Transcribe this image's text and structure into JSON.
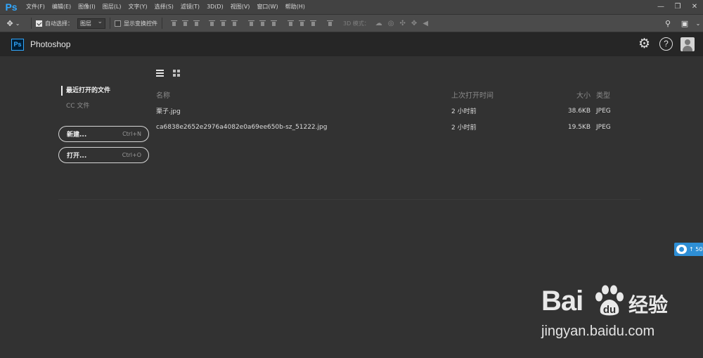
{
  "menubar": {
    "logo": "Ps",
    "items": [
      "文件(F)",
      "编辑(E)",
      "图像(I)",
      "图层(L)",
      "文字(Y)",
      "选择(S)",
      "滤镜(T)",
      "3D(D)",
      "视图(V)",
      "窗口(W)",
      "帮助(H)"
    ],
    "window_controls": [
      "—",
      "❐",
      "✕"
    ]
  },
  "optionsbar": {
    "move_tool": "✥",
    "auto_select_label": "自动选择：",
    "auto_select_checked": true,
    "auto_select_target": "图层",
    "show_transform_label": "显示变换控件",
    "show_transform_checked": false,
    "mode_3d_label": "3D 模式：",
    "icons_3d": [
      "☁",
      "◎",
      "✣",
      "✥",
      "◀"
    ]
  },
  "app": {
    "badge": "Ps",
    "name": "Photoshop",
    "brand_color": "#31a8ff"
  },
  "sidebar": {
    "items": [
      {
        "label": "最近打开的文件",
        "active": true
      },
      {
        "label": "CC 文件",
        "active": false
      }
    ],
    "new_button": {
      "label": "新建...",
      "shortcut": "Ctrl+N"
    },
    "open_button": {
      "label": "打开...",
      "shortcut": "Ctrl+O"
    }
  },
  "files": {
    "headers": {
      "name": "名称",
      "time": "上次打开时间",
      "size": "大小",
      "type": "类型"
    },
    "rows": [
      {
        "name": "栗子.jpg",
        "time": "2 小时前",
        "size": "38.6KB",
        "type": "JPEG"
      },
      {
        "name": "ca6838e2652e2976a4082e0a69ee650b-sz_51222.jpg",
        "time": "2 小时前",
        "size": "19.5KB",
        "type": "JPEG"
      }
    ]
  },
  "side_tag": {
    "text": "↑ 50"
  },
  "watermark": {
    "logo_left": "Bai",
    "logo_right": "经验",
    "url": "jingyan.baidu.com"
  }
}
